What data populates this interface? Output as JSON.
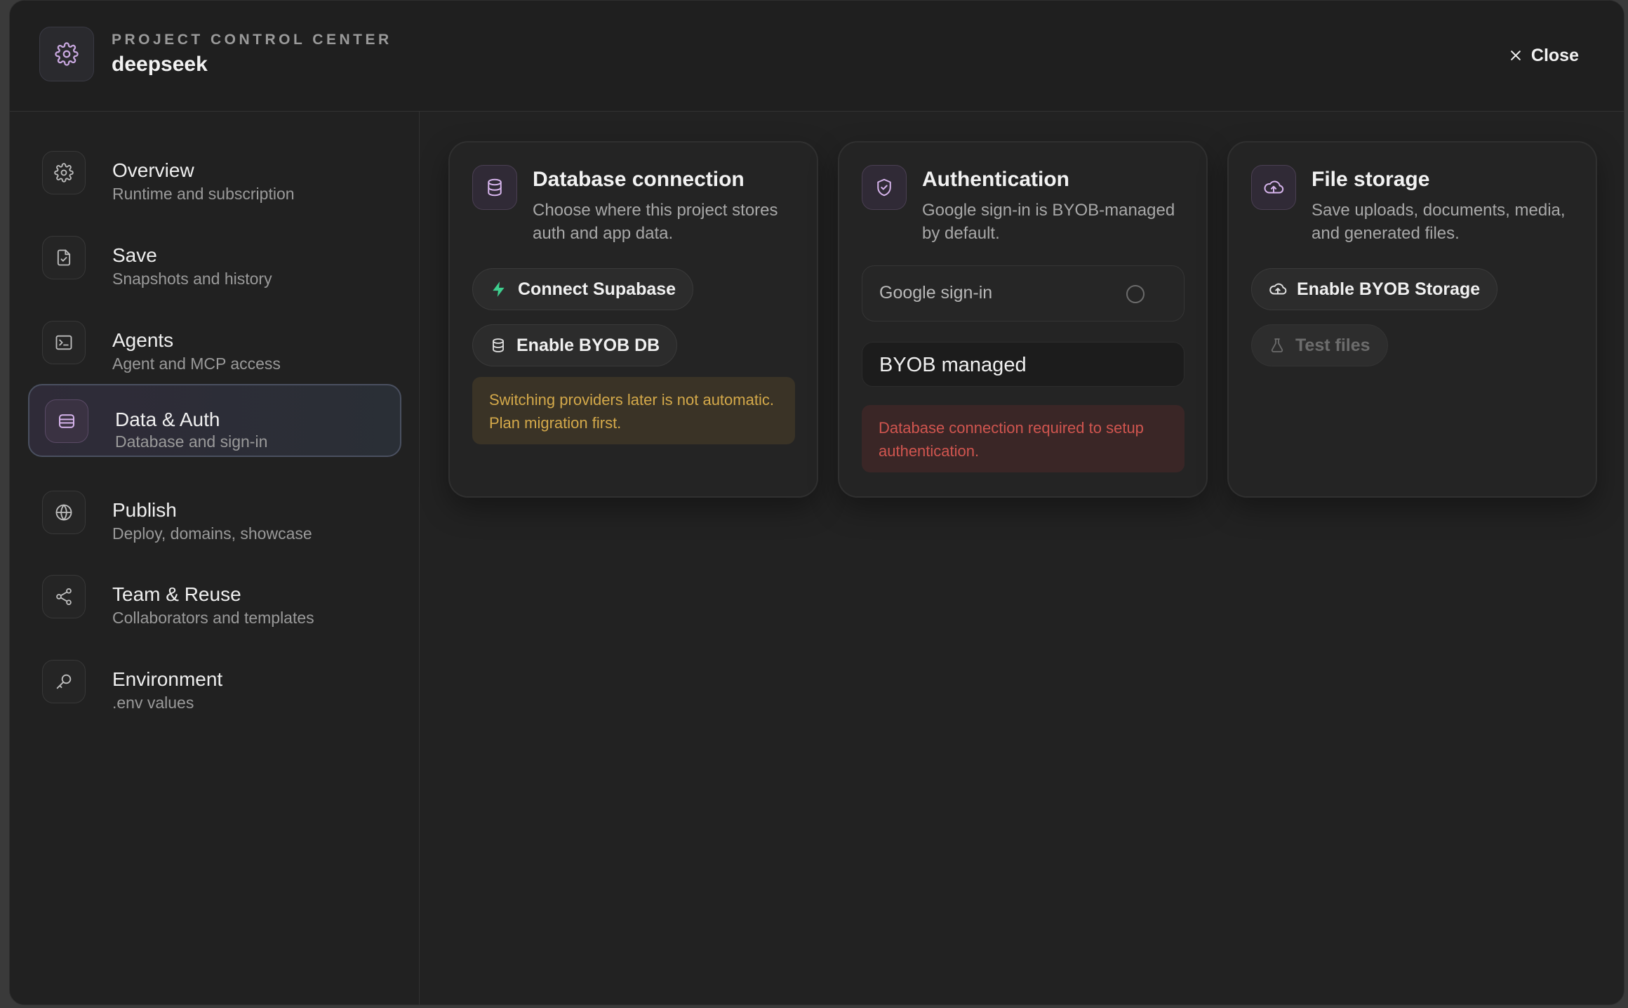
{
  "header": {
    "kicker": "PROJECT CONTROL CENTER",
    "project_name": "deepseek",
    "close_label": "Close"
  },
  "sidebar": {
    "items": [
      {
        "title": "Overview",
        "subtitle": "Runtime and subscription",
        "icon": "gear-icon"
      },
      {
        "title": "Save",
        "subtitle": "Snapshots and history",
        "icon": "file-check-icon"
      },
      {
        "title": "Agents",
        "subtitle": "Agent and MCP access",
        "icon": "terminal-icon"
      },
      {
        "title": "Data & Auth",
        "subtitle": "Database and sign-in",
        "icon": "database-icon",
        "active": true
      },
      {
        "title": "Publish",
        "subtitle": "Deploy, domains, showcase",
        "icon": "globe-icon"
      },
      {
        "title": "Team & Reuse",
        "subtitle": "Collaborators and templates",
        "icon": "share-icon"
      },
      {
        "title": "Environment",
        "subtitle": ".env values",
        "icon": "key-icon"
      }
    ]
  },
  "database": {
    "title": "Database connection",
    "description": "Choose where this project stores auth and app data.",
    "connect_label": "Connect Supabase",
    "byob_label": "Enable BYOB DB",
    "warning": "Switching providers later is not automatic. Plan migration first."
  },
  "auth": {
    "title": "Authentication",
    "description": "Google sign-in is BYOB-managed by default.",
    "toggle_label": "Google sign-in",
    "select_value": "BYOB managed",
    "error": "Database connection required to setup authentication."
  },
  "storage": {
    "title": "File storage",
    "description": "Save uploads, documents, media, and generated files.",
    "enable_label": "Enable BYOB Storage",
    "test_label": "Test files"
  },
  "colors": {
    "background": "#222222",
    "accent_icon": "#c9a8e0",
    "warning_text": "#d4a94a",
    "error_text": "#d0554f",
    "supabase_green": "#3ecf8e"
  }
}
